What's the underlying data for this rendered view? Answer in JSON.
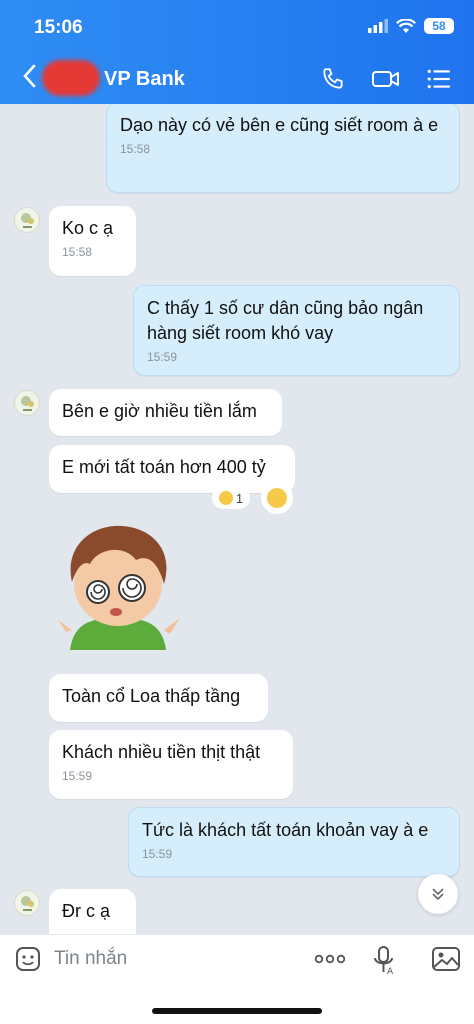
{
  "status_bar": {
    "time": "15:06",
    "battery": "58"
  },
  "header": {
    "title": "VP Bank",
    "icons": [
      "back-chevron-icon",
      "phone-icon",
      "video-call-icon",
      "list-menu-icon"
    ]
  },
  "messages": [
    {
      "sender": "me",
      "text": "Dạo này có vẻ bên e cũng siết room à e",
      "time": "15:58"
    },
    {
      "sender": "them",
      "text": "Ko c ạ",
      "time": "15:58"
    },
    {
      "sender": "me",
      "text": "C thấy 1 số cư dân cũng bảo ngân hàng siết room khó vay",
      "time": "15:59"
    },
    {
      "sender": "them",
      "text": "Bên e giờ nhiều tiền lắm"
    },
    {
      "sender": "them",
      "text": "E mới tất toán hơn 400 tỷ",
      "reaction": {
        "emoji": "dizzy-face-emoji",
        "count": "1"
      }
    },
    {
      "sender": "them",
      "type": "sticker",
      "sticker": "dizzy-cartoon-boy-sticker"
    },
    {
      "sender": "them",
      "text": "Toàn cổ Loa thấp tầng"
    },
    {
      "sender": "them",
      "text": "Khách nhiều tiền thịt thật",
      "time": "15:59"
    },
    {
      "sender": "me",
      "text": "Tức là khách tất toán khoản vay à e",
      "time": "15:59"
    },
    {
      "sender": "them",
      "text": "Đr c ạ"
    }
  ],
  "composer": {
    "placeholder": "Tin nhắn",
    "icons": [
      "sticker-icon",
      "more-icon",
      "voice-translate-icon",
      "image-icon"
    ]
  },
  "colors": {
    "header": "#2a85f2",
    "my_bubble": "#d6eefc",
    "their_bubble": "#ffffff",
    "chat_bg": "#e2e7ee"
  }
}
